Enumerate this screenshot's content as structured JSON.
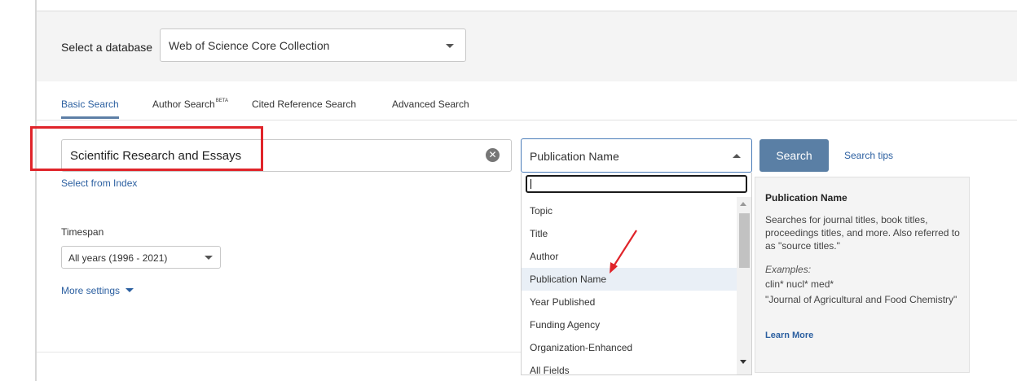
{
  "database": {
    "label": "Select a database",
    "selected": "Web of Science Core Collection"
  },
  "tabs": {
    "basic": "Basic Search",
    "author": "Author Search",
    "author_badge": "BETA",
    "cited": "Cited Reference Search",
    "advanced": "Advanced Search"
  },
  "search": {
    "query": "Scientific Research and Essays",
    "select_from_index": "Select from Index",
    "field_selected": "Publication Name",
    "button": "Search",
    "tips": "Search tips",
    "filter_value": ""
  },
  "field_options": [
    "Topic",
    "Title",
    "Author",
    "Publication Name",
    "Year Published",
    "Funding Agency",
    "Organization-Enhanced",
    "All Fields"
  ],
  "selected_option_index": 3,
  "tooltip": {
    "title": "Publication Name",
    "description": "Searches for journal titles, book titles, proceedings titles, and more. Also referred to as \"source titles.\"",
    "examples_heading": "Examples:",
    "example_1": "clin* nucl* med*",
    "example_2": "\"Journal of Agricultural and Food Chemistry\"",
    "learn_more": "Learn More"
  },
  "timespan": {
    "label": "Timespan",
    "selected": "All years (1996 - 2021)"
  },
  "more_settings": "More settings",
  "colors": {
    "accent": "#5a7fa5",
    "link": "#2b5fa0",
    "annotation": "#e0242a"
  }
}
